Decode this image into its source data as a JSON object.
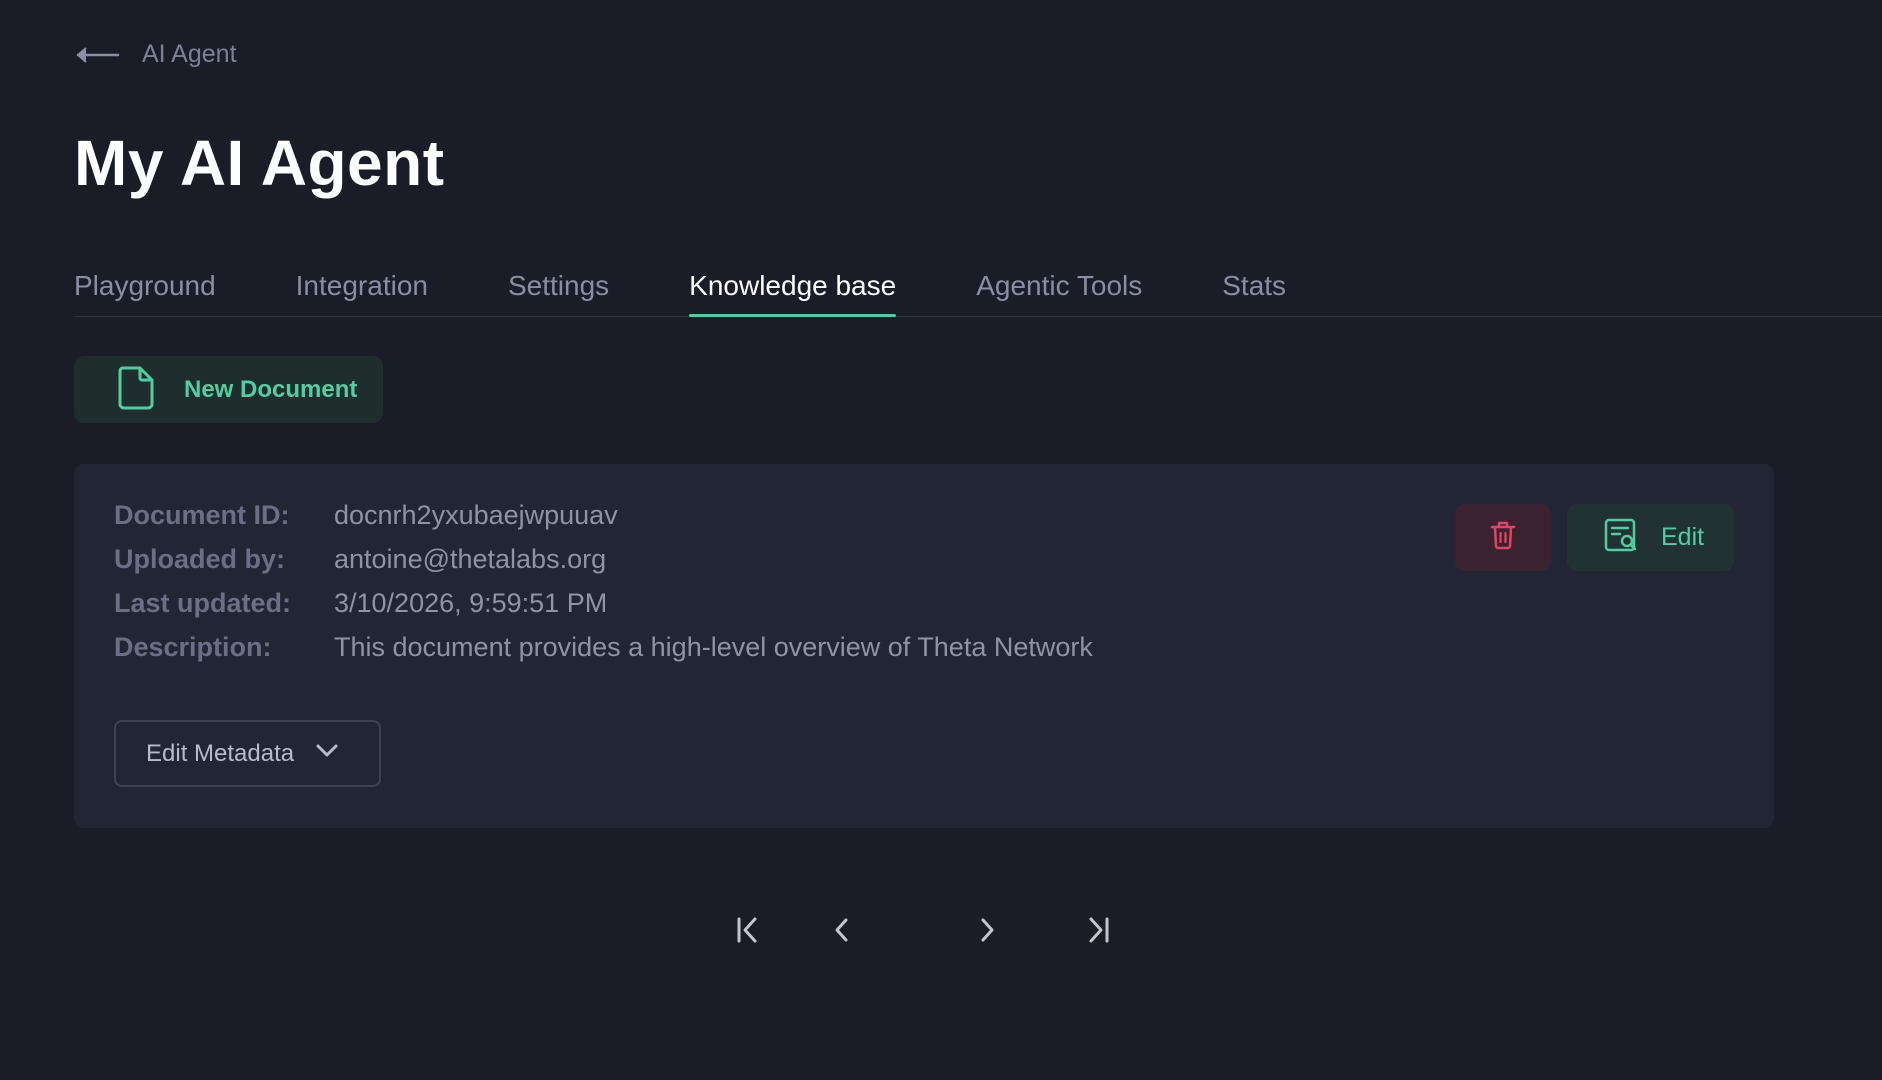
{
  "breadcrumb": {
    "back_icon": "arrow-left-icon",
    "label": "AI Agent"
  },
  "page_title": "My AI Agent",
  "tabs": [
    {
      "label": "Playground",
      "active": false
    },
    {
      "label": "Integration",
      "active": false
    },
    {
      "label": "Settings",
      "active": false
    },
    {
      "label": "Knowledge base",
      "active": true
    },
    {
      "label": "Agentic Tools",
      "active": false
    },
    {
      "label": "Stats",
      "active": false
    }
  ],
  "new_document": {
    "icon": "document-icon",
    "label": "New Document"
  },
  "document": {
    "fields": [
      {
        "key": "Document ID:",
        "value": "docnrh2yxubaejwpuuav"
      },
      {
        "key": "Uploaded by:",
        "value": "antoine@thetalabs.org"
      },
      {
        "key": "Last updated:",
        "value": "3/10/2026, 9:59:51 PM"
      },
      {
        "key": "Description:",
        "value": "This document provides a high-level overview of Theta Network"
      }
    ],
    "delete_icon": "trash-icon",
    "edit_icon": "document-search-icon",
    "edit_label": "Edit",
    "edit_metadata_label": "Edit Metadata",
    "edit_metadata_icon": "chevron-down-icon"
  },
  "pagination": {
    "first_icon": "first-page-icon",
    "prev_icon": "chevron-left-icon",
    "next_icon": "chevron-right-icon",
    "last_icon": "last-page-icon"
  },
  "colors": {
    "background": "#1a1d28",
    "card": "#222533",
    "accent": "#4fcf9f",
    "danger": "#e0475e"
  }
}
